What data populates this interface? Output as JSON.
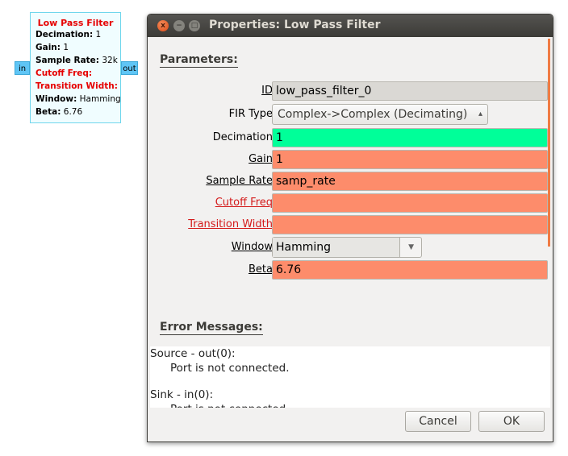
{
  "block": {
    "title": "Low Pass Filter",
    "lines": [
      {
        "key": "Decimation:",
        "value": " 1",
        "error": false
      },
      {
        "key": "Gain:",
        "value": " 1",
        "error": false
      },
      {
        "key": "Sample Rate:",
        "value": " 32k",
        "error": false
      },
      {
        "key": "Cutoff Freq:",
        "value": "",
        "error": true
      },
      {
        "key": "Transition Width:",
        "value": "",
        "error": true
      },
      {
        "key": "Window:",
        "value": " Hamming",
        "error": false
      },
      {
        "key": "Beta:",
        "value": " 6.76",
        "error": false
      }
    ],
    "in_port": "in",
    "out_port": "out"
  },
  "dialog": {
    "title": "Properties: Low Pass Filter",
    "window_buttons": {
      "close": "x",
      "min": "−",
      "max": "□"
    },
    "params_heading": "Parameters:",
    "params": {
      "id": {
        "label": "ID",
        "value": "low_pass_filter_0"
      },
      "fir_type": {
        "label": "FIR Type",
        "value": "Complex->Complex (Decimating)"
      },
      "decimation": {
        "label": "Decimation",
        "value": "1"
      },
      "gain": {
        "label": "Gain",
        "value": "1"
      },
      "samp_rate": {
        "label": "Sample Rate",
        "value": "samp_rate"
      },
      "cutoff": {
        "label": "Cutoff Freq",
        "value": ""
      },
      "transition": {
        "label": "Transition Width",
        "value": ""
      },
      "window": {
        "label": "Window",
        "value": "Hamming"
      },
      "beta": {
        "label": "Beta",
        "value": "6.76"
      }
    },
    "errors_heading": "Error Messages:",
    "errors": [
      {
        "source": "Source - out(0):",
        "message": "Port is not connected."
      },
      {
        "source": "Sink - in(0):",
        "message": "Port is not connected."
      }
    ],
    "buttons": {
      "cancel": "Cancel",
      "ok": "OK"
    }
  },
  "colors": {
    "ok_field": "#00ff99",
    "error_field": "#fd8c6b",
    "readonly_field": "#dad8d4",
    "error_text": "#d41b1b",
    "titlebar": "#3c3b37"
  }
}
